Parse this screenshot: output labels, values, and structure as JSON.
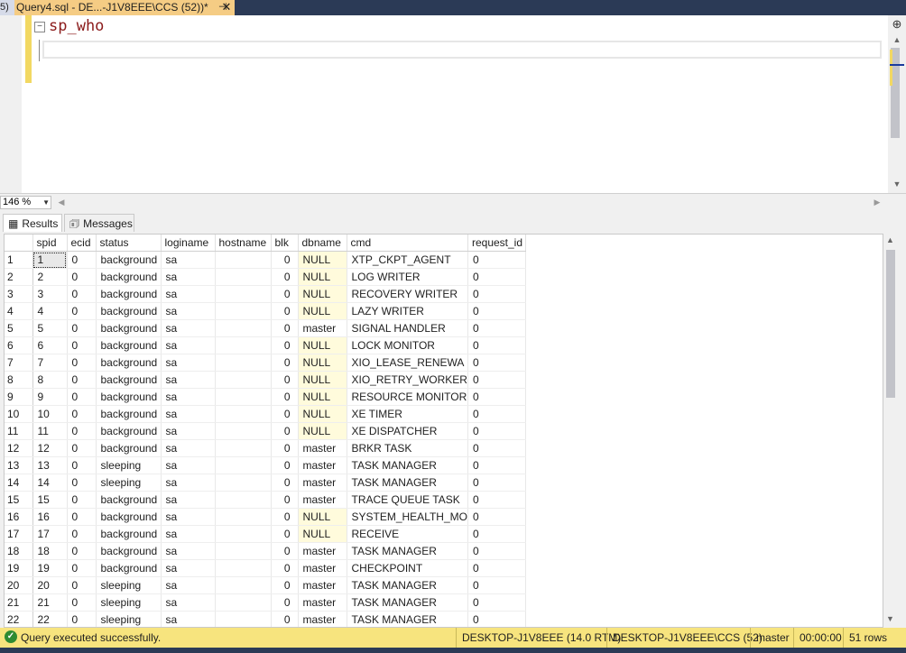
{
  "tabs": {
    "previous_tab_label": "5)",
    "active_tab_title": "Query4.sql - DE...-J1V8EEE\\CCS (52))*",
    "pin_glyph": "⊣",
    "close_glyph": "✕"
  },
  "editor": {
    "code": "sp_who",
    "collapse_glyph": "−"
  },
  "zoom": {
    "value": "146 %"
  },
  "results_tabs": {
    "results_label": "Results",
    "messages_label": "Messages"
  },
  "grid": {
    "columns": [
      "spid",
      "ecid",
      "status",
      "loginame",
      "hostname",
      "blk",
      "dbname",
      "cmd",
      "request_id"
    ],
    "rows": [
      [
        "1",
        "1",
        "0",
        "background",
        "sa",
        "",
        "0",
        "NULL",
        "XTP_CKPT_AGENT",
        "0"
      ],
      [
        "2",
        "2",
        "0",
        "background",
        "sa",
        "",
        "0",
        "NULL",
        "LOG WRITER",
        "0"
      ],
      [
        "3",
        "3",
        "0",
        "background",
        "sa",
        "",
        "0",
        "NULL",
        "RECOVERY WRITER",
        "0"
      ],
      [
        "4",
        "4",
        "0",
        "background",
        "sa",
        "",
        "0",
        "NULL",
        "LAZY WRITER",
        "0"
      ],
      [
        "5",
        "5",
        "0",
        "background",
        "sa",
        "",
        "0",
        "master",
        "SIGNAL HANDLER",
        "0"
      ],
      [
        "6",
        "6",
        "0",
        "background",
        "sa",
        "",
        "0",
        "NULL",
        "LOCK MONITOR",
        "0"
      ],
      [
        "7",
        "7",
        "0",
        "background",
        "sa",
        "",
        "0",
        "NULL",
        "XIO_LEASE_RENEWA",
        "0"
      ],
      [
        "8",
        "8",
        "0",
        "background",
        "sa",
        "",
        "0",
        "NULL",
        "XIO_RETRY_WORKER",
        "0"
      ],
      [
        "9",
        "9",
        "0",
        "background",
        "sa",
        "",
        "0",
        "NULL",
        "RESOURCE MONITOR",
        "0"
      ],
      [
        "10",
        "10",
        "0",
        "background",
        "sa",
        "",
        "0",
        "NULL",
        "XE TIMER",
        "0"
      ],
      [
        "11",
        "11",
        "0",
        "background",
        "sa",
        "",
        "0",
        "NULL",
        "XE DISPATCHER",
        "0"
      ],
      [
        "12",
        "12",
        "0",
        "background",
        "sa",
        "",
        "0",
        "master",
        "BRKR TASK",
        "0"
      ],
      [
        "13",
        "13",
        "0",
        "sleeping",
        "sa",
        "",
        "0",
        "master",
        "TASK MANAGER",
        "0"
      ],
      [
        "14",
        "14",
        "0",
        "sleeping",
        "sa",
        "",
        "0",
        "master",
        "TASK MANAGER",
        "0"
      ],
      [
        "15",
        "15",
        "0",
        "background",
        "sa",
        "",
        "0",
        "master",
        "TRACE QUEUE TASK",
        "0"
      ],
      [
        "16",
        "16",
        "0",
        "background",
        "sa",
        "",
        "0",
        "NULL",
        "SYSTEM_HEALTH_MO",
        "0"
      ],
      [
        "17",
        "17",
        "0",
        "background",
        "sa",
        "",
        "0",
        "NULL",
        "RECEIVE",
        "0"
      ],
      [
        "18",
        "18",
        "0",
        "background",
        "sa",
        "",
        "0",
        "master",
        "TASK MANAGER",
        "0"
      ],
      [
        "19",
        "19",
        "0",
        "background",
        "sa",
        "",
        "0",
        "master",
        "CHECKPOINT",
        "0"
      ],
      [
        "20",
        "20",
        "0",
        "sleeping",
        "sa",
        "",
        "0",
        "master",
        "TASK MANAGER",
        "0"
      ],
      [
        "21",
        "21",
        "0",
        "sleeping",
        "sa",
        "",
        "0",
        "master",
        "TASK MANAGER",
        "0"
      ],
      [
        "22",
        "22",
        "0",
        "sleeping",
        "sa",
        "",
        "0",
        "master",
        "TASK MANAGER",
        "0"
      ]
    ]
  },
  "status": {
    "message": "Query executed successfully.",
    "server": "DESKTOP-J1V8EEE (14.0 RTM)",
    "connection": "DESKTOP-J1V8EEE\\CCS (52)",
    "database": "master",
    "elapsed": "00:00:00",
    "rows": "51 rows"
  },
  "colors": {
    "accent_tab": "#f5cc84",
    "status_bar": "#f7e47e",
    "null_cell": "#fffbdc",
    "frame": "#2b3a56"
  }
}
